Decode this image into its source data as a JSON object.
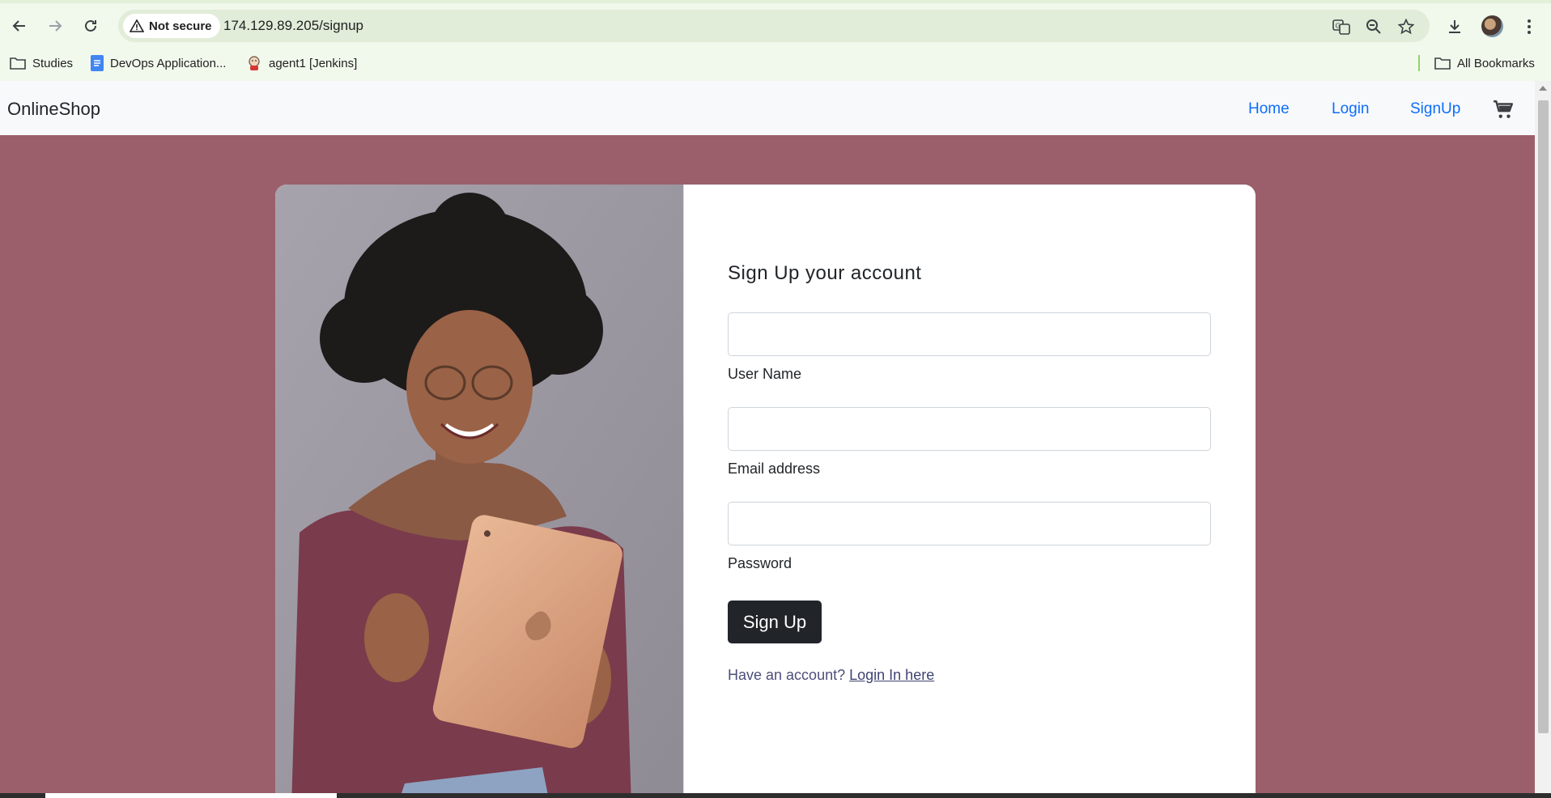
{
  "browser": {
    "security_label": "Not secure",
    "url": "174.129.89.205/signup",
    "bookmarks": [
      {
        "label": "Studies",
        "icon": "folder-icon"
      },
      {
        "label": "DevOps Application...",
        "icon": "google-docs-icon"
      },
      {
        "label": "agent1 [Jenkins]",
        "icon": "jenkins-icon"
      }
    ],
    "all_bookmarks_label": "All Bookmarks"
  },
  "navbar": {
    "brand": "OnlineShop",
    "links": [
      "Home",
      "Login",
      "SignUp"
    ],
    "cart_icon": "shopping-cart-icon",
    "link_color": "#0d6efd"
  },
  "form": {
    "title": "Sign Up your account",
    "fields": [
      {
        "label": "User Name",
        "value": ""
      },
      {
        "label": "Email address",
        "value": ""
      },
      {
        "label": "Password",
        "value": ""
      }
    ],
    "submit_label": "Sign Up",
    "account_prompt": "Have an account?",
    "login_link": "Login In here"
  },
  "colors": {
    "page_background": "#9b5f6b",
    "button": "#212529"
  }
}
